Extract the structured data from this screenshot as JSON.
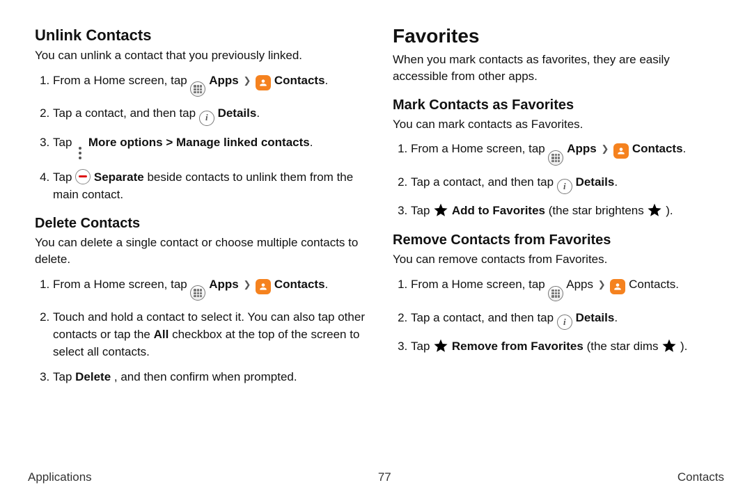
{
  "left": {
    "h2_unlink": "Unlink Contacts",
    "p_unlink": "You can unlink a contact that you previously linked.",
    "step_from": "From a Home screen, tap ",
    "apps_b": "Apps",
    "contacts_b": "Contacts",
    "step2_a": "Tap a contact, and then tap ",
    "details_b": "Details",
    "step3_a": "Tap ",
    "step3_b": "More options > Manage linked contacts",
    "step4_a": "Tap ",
    "step4_b": "Separate",
    "step4_c": " beside contacts to unlink them from the main contact.",
    "h2_delete": "Delete Contacts",
    "p_delete": "You can delete a single contact or choose multiple contacts to delete.",
    "del2_a": "Touch and hold a contact to select it. You can also tap other contacts or tap the ",
    "del2_b": "All",
    "del2_c": " checkbox at the top of the screen to select all contacts.",
    "del3_a": "Tap ",
    "del3_b": "Delete",
    "del3_c": ", and then confirm when prompted."
  },
  "right": {
    "h1_fav": "Favorites",
    "p_fav": "When you mark contacts as favorites, they are easily accessible from other apps.",
    "h3_mark": "Mark Contacts as Favorites",
    "p_mark": "You can mark contacts as Favorites.",
    "step_from": "From a Home screen, tap ",
    "apps_b": "Apps",
    "contacts_b": "Contacts",
    "step2_a": "Tap a contact, and then tap ",
    "details_b": "Details",
    "mark3_a": "Tap ",
    "mark3_b": "Add to Favorites",
    "mark3_c": " (the star brightens ",
    "mark3_d": ").",
    "h3_remove": "Remove Contacts from Favorites",
    "p_remove": "You can remove contacts from Favorites.",
    "rem1_apps": "Apps",
    "rem1_contacts": "Contacts",
    "rem3_a": "Tap ",
    "rem3_b": "Remove from Favorites",
    "rem3_c": " (the star dims ",
    "rem3_d": ")."
  },
  "footer": {
    "left": "Applications",
    "page": "77",
    "right": "Contacts"
  },
  "period": "."
}
